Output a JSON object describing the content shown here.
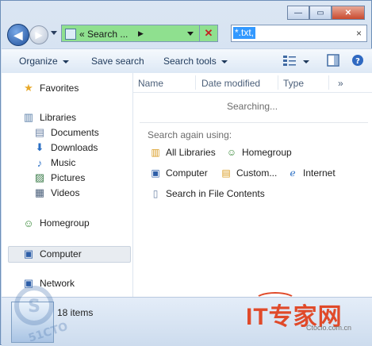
{
  "window": {
    "caption_buttons": {
      "minimize": "—",
      "maximize": "▭",
      "close": "✕"
    }
  },
  "address": {
    "crumb": "« Search ...",
    "crumb_arrow": "▶",
    "search_value": "*.txt,",
    "clear": "×"
  },
  "toolbar": {
    "organize": "Organize",
    "save_search": "Save search",
    "search_tools": "Search tools"
  },
  "nav": {
    "favorites": "Favorites",
    "libraries": "Libraries",
    "library_items": [
      "Documents",
      "Downloads",
      "Music",
      "Pictures",
      "Videos"
    ],
    "homegroup": "Homegroup",
    "computer": "Computer",
    "network": "Network"
  },
  "columns": {
    "name": "Name",
    "date_modified": "Date modified",
    "type": "Type",
    "more": "»"
  },
  "results": {
    "status": "Searching...",
    "search_again": "Search again using:",
    "options": [
      "All Libraries",
      "Homegroup",
      "Computer",
      "Custom...",
      "Internet",
      "Search in File Contents"
    ]
  },
  "status": {
    "item_count": "18 items"
  },
  "watermark": {
    "site_text": "IT专家网",
    "site_url": "Ctocio.com.cn",
    "logo_text": "51CTO"
  },
  "colors": {
    "address_bar": "#8fe08f",
    "selection": "#3399ff",
    "watermark_red": "#e04a2a"
  }
}
